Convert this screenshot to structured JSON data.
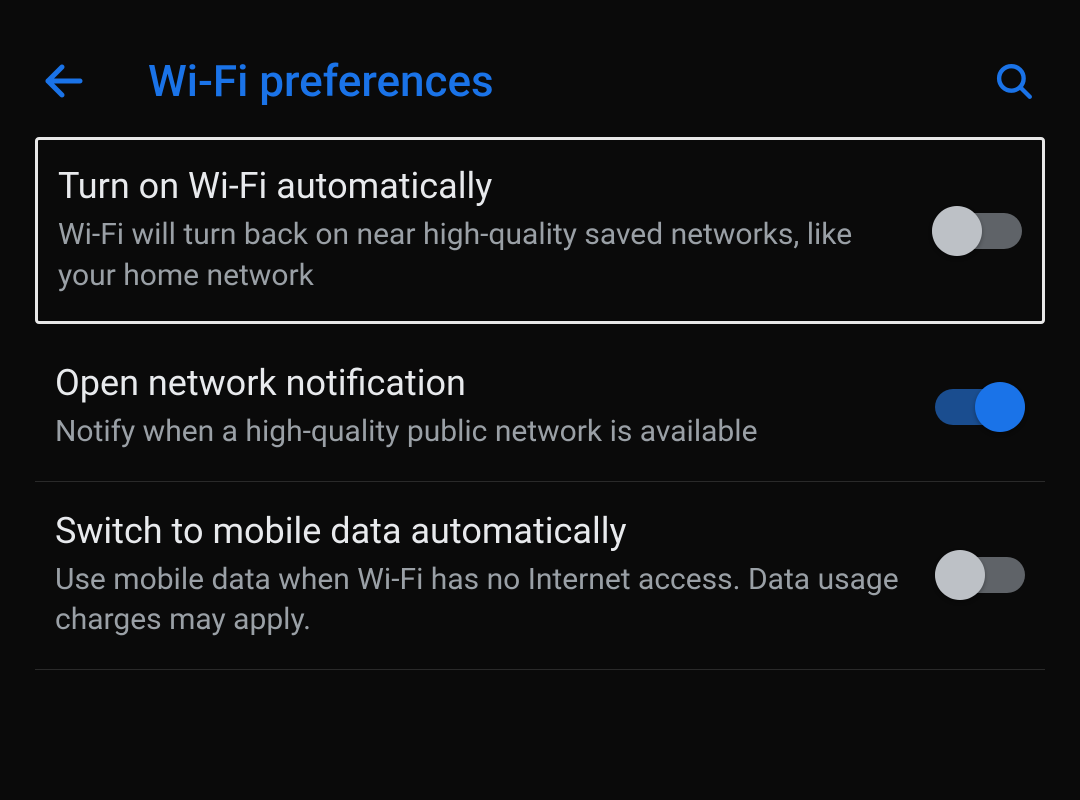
{
  "header": {
    "title": "Wi-Fi preferences"
  },
  "settings": [
    {
      "title": "Turn on Wi-Fi automatically",
      "description": "Wi-Fi will turn back on near high-quality saved networks, like your home network",
      "enabled": false,
      "highlighted": true
    },
    {
      "title": "Open network notification",
      "description": "Notify when a high-quality public network is available",
      "enabled": true,
      "highlighted": false
    },
    {
      "title": "Switch to mobile data automatically",
      "description": "Use mobile data when Wi-Fi has no Internet access. Data usage charges may apply.",
      "enabled": false,
      "highlighted": false
    }
  ]
}
